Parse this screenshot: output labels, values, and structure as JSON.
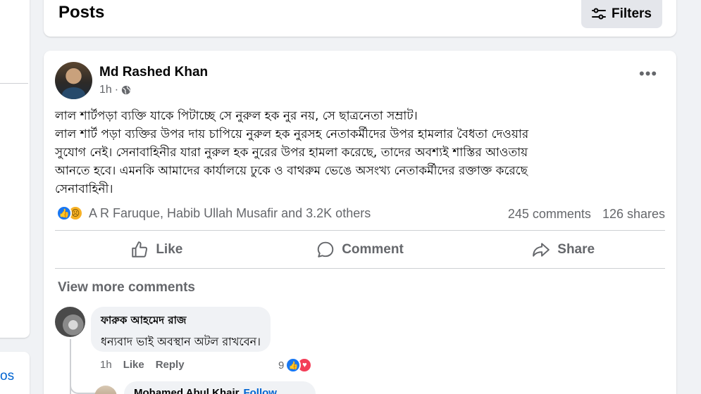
{
  "header": {
    "title": "Posts",
    "filters_label": "Filters"
  },
  "sidebar": {
    "partial_link": "os"
  },
  "post": {
    "author": "Md Rashed Khan",
    "time": "1h",
    "privacy_icon": "globe-icon",
    "text_lines": [
      "লাল শার্টপড়া ব্যক্তি যাকে পিটাচ্ছে সে নুরুল হক নুর নয়, সে ছাত্রনেতা সম্রাট।",
      "লাল শার্ট পড়া ব্যক্তির উপর দায় চাপিয়ে নুরুল হক নুরসহ নেতাকর্মীদের উপর হামলার বৈধতা দেওয়ার",
      "সুযোগ নেই। সেনাবাহিনীর যারা নুরুল হক নুরের উপর হামলা করেছে, তাদের অবশ্যই শাস্তির আওতায়",
      "আনতে হবে। এমনকি আমাদের কার্যালয়ে ঢুকে ও বাথরুম ভেঙে অসংখ্য নেতাকর্মীদের রক্তাক্ত করেছে",
      "সেনাবাহিনী।"
    ],
    "reactions_text": "A R Faruque, Habib Ullah Musafir and 3.2K others",
    "comments_count": "245 comments",
    "shares_count": "126 shares",
    "actions": {
      "like": "Like",
      "comment": "Comment",
      "share": "Share"
    },
    "view_more": "View more comments"
  },
  "comment": {
    "author": "ফারুক আহমেদ রাজ",
    "text": "ধন্যবাদ ভাই অবস্থান অটল রাখবেন।",
    "time": "1h",
    "like": "Like",
    "reply": "Reply",
    "reaction_count": "9"
  },
  "reply_preview": {
    "author": "Mohamed Abul Khair",
    "follow": "Follow"
  },
  "colors": {
    "accent": "#1877f2",
    "love": "#f33e58",
    "sad": "#f7b125",
    "muted": "#65676b"
  }
}
